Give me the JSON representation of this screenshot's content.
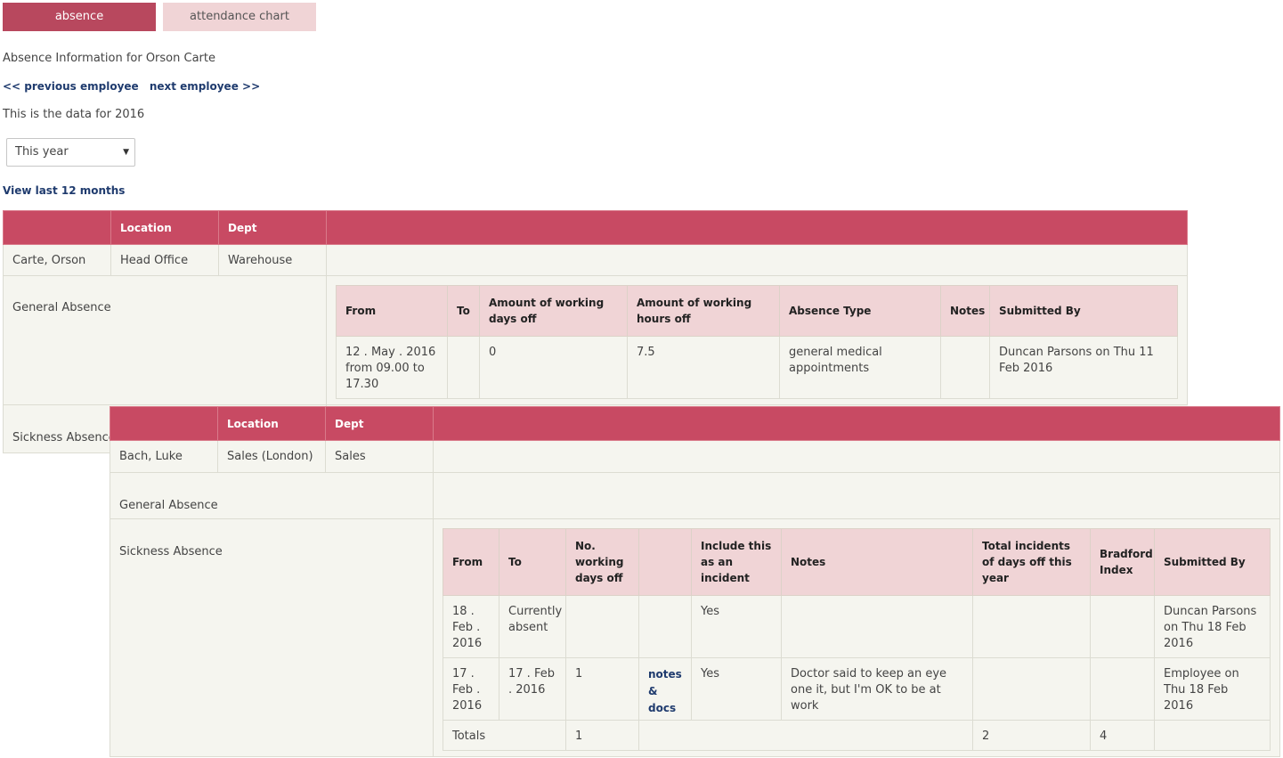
{
  "tabs": {
    "absence": "absence",
    "attendance_chart": "attendance chart"
  },
  "heading": "Absence Information for Orson Carte",
  "nav": {
    "previous": "<< previous employee",
    "next": "next employee >>"
  },
  "data_year_text": "This is the data for 2016",
  "period_select": {
    "value": "This year",
    "caret": "▼"
  },
  "view_last_12": "View last 12 months",
  "employee1": {
    "col_location": "Location",
    "col_dept": "Dept",
    "name": "Carte, Orson",
    "location": "Head Office",
    "dept": "Warehouse",
    "general_label": "General Absence",
    "sickness_label": "Sickness Absence",
    "general_headers": {
      "from": "From",
      "to": "To",
      "days": "Amount of working days off",
      "hours": "Amount of working hours off",
      "type": "Absence Type",
      "notes": "Notes",
      "submitted": "Submitted By"
    },
    "general_rows": [
      {
        "from": "12 . May . 2016 from 09.00 to 17.30",
        "to": "",
        "days": "0",
        "hours": "7.5",
        "type": "general medical appointments",
        "notes": "",
        "submitted": "Duncan Parsons on Thu 11 Feb 2016"
      }
    ]
  },
  "employee2": {
    "col_location": "Location",
    "col_dept": "Dept",
    "name": "Bach, Luke",
    "location": "Sales (London)",
    "dept": "Sales",
    "general_label": "General Absence",
    "sickness_label": "Sickness Absence",
    "sickness_headers": {
      "from": "From",
      "to": "To",
      "days": "No. working days off",
      "docs": "",
      "incident": "Include this as an incident",
      "notes": "Notes",
      "total": "Total incidents of days off this year",
      "bradford": "Bradford Index",
      "submitted": "Submitted By"
    },
    "sickness_rows": [
      {
        "from": "18 . Feb . 2016",
        "to": "Currently absent",
        "days": "",
        "docs": "",
        "incident": "Yes",
        "notes": "",
        "total": "",
        "bradford": "",
        "submitted": "Duncan Parsons on Thu 18 Feb 2016"
      },
      {
        "from": "17 . Feb . 2016",
        "to": "17 . Feb . 2016",
        "days": "1",
        "docs": "notes & docs",
        "incident": "Yes",
        "notes": "Doctor said to keep an eye one it, but I'm OK to be at work",
        "total": "",
        "bradford": "",
        "submitted": "Employee on Thu 18 Feb 2016"
      }
    ],
    "totals": {
      "label": "Totals",
      "days": "1",
      "total": "2",
      "bradford": "4"
    }
  },
  "colors": {
    "tab_active": "#b8485e",
    "tab_inactive": "#f0d4d6",
    "header_bar": "#c84a63",
    "inner_header": "#f0d4d6",
    "link": "#1f3b6e",
    "status_red": "#d62a2a"
  }
}
